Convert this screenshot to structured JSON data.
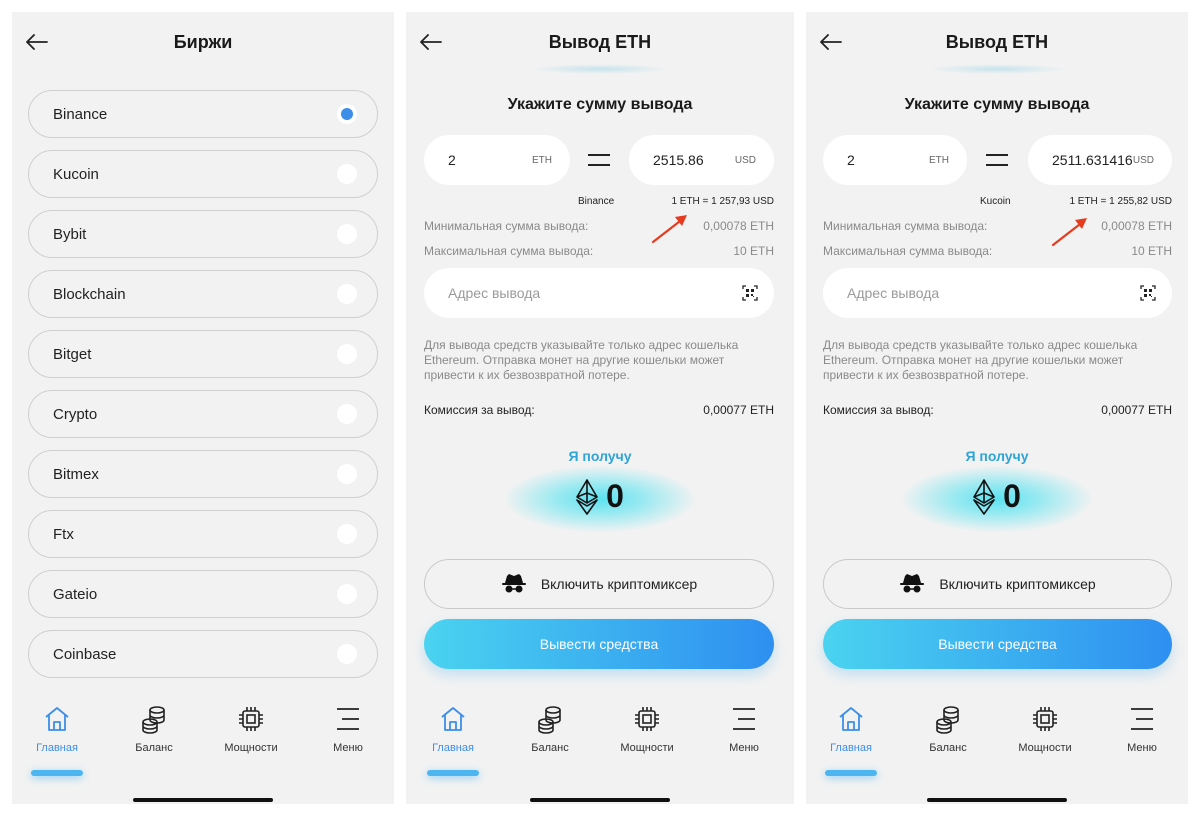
{
  "screen1": {
    "title": "Биржи",
    "exchanges": [
      {
        "name": "Binance",
        "selected": true
      },
      {
        "name": "Kucoin",
        "selected": false
      },
      {
        "name": "Bybit",
        "selected": false
      },
      {
        "name": "Blockchain",
        "selected": false
      },
      {
        "name": "Bitget",
        "selected": false
      },
      {
        "name": "Crypto",
        "selected": false
      },
      {
        "name": "Bitmex",
        "selected": false
      },
      {
        "name": "Ftx",
        "selected": false
      },
      {
        "name": "Gateio",
        "selected": false
      },
      {
        "name": "Coinbase",
        "selected": false
      }
    ]
  },
  "screen2": {
    "title": "Вывод ETH",
    "subtitle": "Укажите сумму вывода",
    "eth_value": "2",
    "eth_unit": "ETH",
    "usd_value": "2515.86",
    "usd_unit": "USD",
    "exchange": "Binance",
    "rate": "1 ETH  =  1 257,93 USD",
    "min_label": "Минимальная сумма вывода:",
    "min_value": "0,00078 ETH",
    "max_label": "Максимальная сумма вывода:",
    "max_value": "10 ETH",
    "address_placeholder": "Адрес вывода",
    "note": "Для вывода средств указывайте только адрес кошелька Ethereum. Отправка монет на другие кошельки может привести к их безвозвратной потере.",
    "fee_label": "Комиссия за вывод:",
    "fee_value": "0,00077 ETH",
    "receive_label": "Я получу",
    "receive_value": "0",
    "mixer_label": "Включить криптомиксер",
    "withdraw_label": "Вывести средства"
  },
  "screen3": {
    "title": "Вывод ETH",
    "subtitle": "Укажите сумму вывода",
    "eth_value": "2",
    "eth_unit": "ETH",
    "usd_value": "2511.631416",
    "usd_unit": "USD",
    "exchange": "Kucoin",
    "rate": "1 ETH  =  1 255,82 USD",
    "min_label": "Минимальная сумма вывода:",
    "min_value": "0,00078 ETH",
    "max_label": "Максимальная сумма вывода:",
    "max_value": "10 ETH",
    "address_placeholder": "Адрес вывода",
    "note": "Для вывода средств указывайте только адрес кошелька Ethereum. Отправка монет на другие кошельки может привести к их безвозвратной потере.",
    "fee_label": "Комиссия за вывод:",
    "fee_value": "0,00077 ETH",
    "receive_label": "Я получу",
    "receive_value": "0",
    "mixer_label": "Включить криптомиксер",
    "withdraw_label": "Вывести средства"
  },
  "nav": {
    "home": "Главная",
    "balance": "Баланс",
    "power": "Мощности",
    "menu": "Меню",
    "active": "home"
  },
  "icons": [
    "back-arrow-icon",
    "radio-icon",
    "qr-code-icon",
    "ethereum-icon",
    "spy-icon",
    "home-icon",
    "coins-icon",
    "chip-icon",
    "menu-icon",
    "annotation-arrow-icon"
  ],
  "colors": {
    "accent": "#3d8ee8",
    "button_gradient_start": "#4ad3f0",
    "button_gradient_end": "#2e8ff0",
    "receive_label": "#2fa4d6",
    "annotation_arrow": "#e53b1f"
  }
}
